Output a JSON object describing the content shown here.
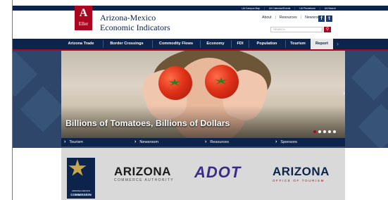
{
  "top_links": [
    "UA Campus Map",
    "UA Calendar/Events",
    "UA Phonebook",
    "UA Search"
  ],
  "logo": {
    "letter": "A",
    "sub": "Eller"
  },
  "site_title_line1": "Arizona-Mexico",
  "site_title_line2": "Economic Indicators",
  "header_links": [
    "About",
    "Resources",
    "Newsroom"
  ],
  "social": {
    "facebook": "f",
    "twitter": "t"
  },
  "search": {
    "placeholder": "SEARCH",
    "button_icon": "search-icon"
  },
  "nav": [
    "Arizona Trade",
    "Border Crossings",
    "Commodity Flows",
    "Economy",
    "FDI",
    "Population",
    "Tourism",
    "Report"
  ],
  "nav_active": "Report",
  "hero": {
    "caption": "Billions of Tomatoes, Billions of Dollars",
    "slides": 5,
    "active_slide": 1
  },
  "bottom_bar": [
    "Tourism",
    "Newsroom",
    "Resources",
    "Sponsors"
  ],
  "sponsors": {
    "azmc": {
      "line1": "ARIZONA-MEXICO",
      "line2": "COMMISSION"
    },
    "aca": {
      "word": "ARIZONA",
      "sub": "COMMERCE AUTHORITY"
    },
    "adot": {
      "word": "ADOT"
    },
    "aot": {
      "word": "ARIZONA",
      "sub": "OFFICE OF TOURISM"
    }
  },
  "colors": {
    "navy": "#0c234b",
    "red": "#ab0520",
    "adot_purple": "#3a2b8c",
    "adot_green": "#2c9f4b"
  }
}
